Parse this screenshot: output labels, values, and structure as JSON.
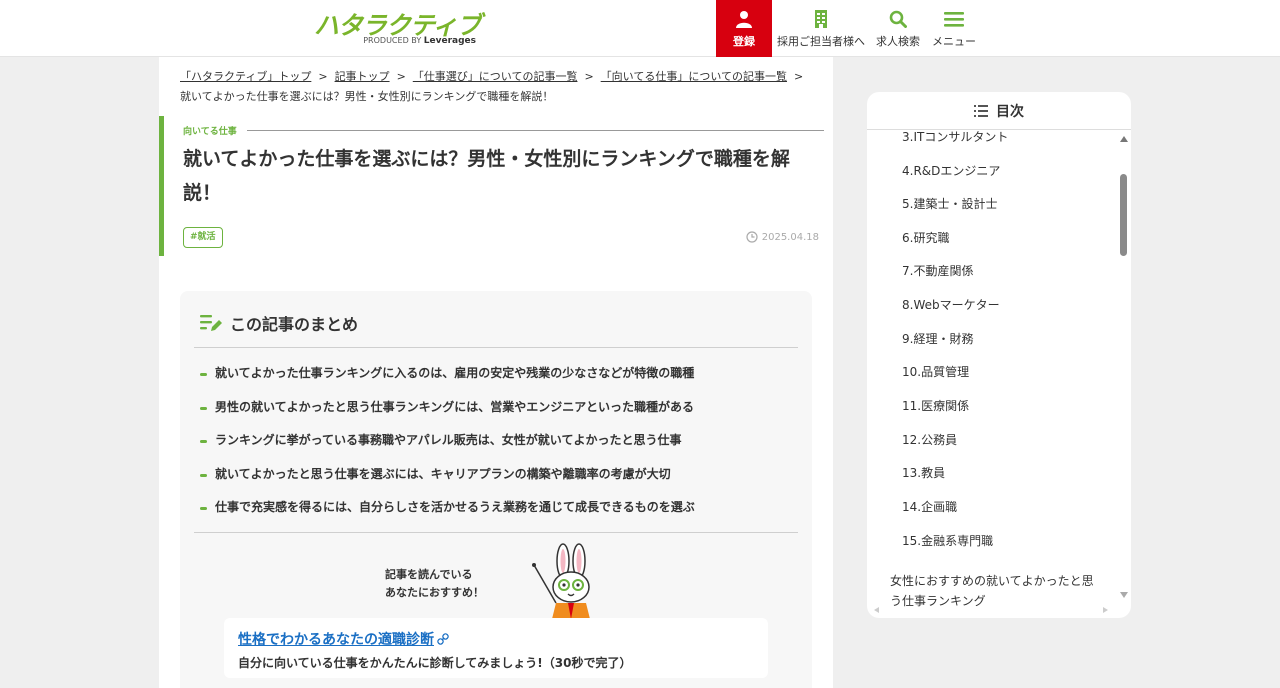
{
  "header": {
    "logo_text": "ハタラクティブ",
    "logo_sub_prefix": "PRODUCED BY",
    "logo_sub_brand": "Leverages",
    "nav": [
      {
        "label": "登録",
        "icon": "user-icon"
      },
      {
        "label": "採用ご担当者様へ",
        "icon": "building-icon"
      },
      {
        "label": "求人検索",
        "icon": "search-icon"
      },
      {
        "label": "メニュー",
        "icon": "hamburger-icon"
      }
    ]
  },
  "breadcrumb": {
    "items": [
      "「ハタラクティブ」トップ",
      "記事トップ",
      "「仕事選び」についての記事一覧",
      "「向いてる仕事」についての記事一覧"
    ],
    "current": "就いてよかった仕事を選ぶには？男性・女性別にランキングで職種を解説！",
    "separator": ">"
  },
  "article": {
    "category": "向いてる仕事",
    "title": "就いてよかった仕事を選ぶには？男性・女性別にランキングで職種を解説！",
    "tag": "#就活",
    "date": "2025.04.18"
  },
  "summary": {
    "heading": "この記事のまとめ",
    "points": [
      "就いてよかった仕事ランキングに入るのは、雇用の安定や残業の少なさなどが特徴の職種",
      "男性の就いてよかったと思う仕事ランキングには、営業やエンジニアといった職種がある",
      "ランキングに挙がっている事務職やアパレル販売は、女性が就いてよかったと思う仕事",
      "就いてよかったと思う仕事を選ぶには、キャリアプランの構築や離職率の考慮が大切",
      "仕事で充実感を得るには、自分らしさを活かせるうえ業務を通じて成長できるものを選ぶ"
    ],
    "promo_line1": "記事を読んでいる",
    "promo_line2": "あなたにおすすめ！",
    "card_link": "性格でわかるあなたの適職診断",
    "card_desc": "自分に向いている仕事をかんたんに診断してみましょう!（30秒で完了）"
  },
  "toc": {
    "heading": "目次",
    "items": [
      "3.ITコンサルタント",
      "4.R&Dエンジニア",
      "5.建築士・設計士",
      "6.研究職",
      "7.不動産関係",
      "8.Webマーケター",
      "9.経理・財務",
      "10.品質管理",
      "11.医療関係",
      "12.公務員",
      "13.教員",
      "14.企画職",
      "15.金融系専門職"
    ],
    "section": "女性におすすめの就いてよかったと思う仕事ランキング"
  },
  "colors": {
    "brand_green": "#6db33f",
    "register_red": "#d7000f",
    "link_blue": "#1a6fc4"
  }
}
